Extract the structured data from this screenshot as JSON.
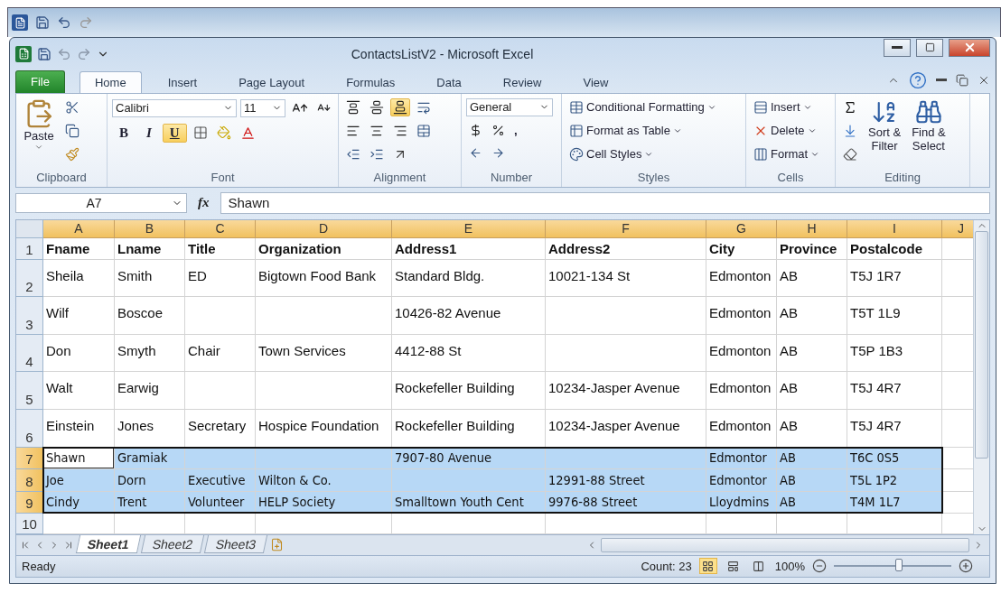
{
  "window": {
    "title": "ContactsListV2 - Microsoft Excel"
  },
  "ribbon_tabs": [
    {
      "label": "File",
      "kind": "file",
      "selected": false
    },
    {
      "label": "Home",
      "kind": "tab",
      "selected": true
    },
    {
      "label": "Insert",
      "kind": "tab",
      "selected": false
    },
    {
      "label": "Page Layout",
      "kind": "tab",
      "selected": false
    },
    {
      "label": "Formulas",
      "kind": "tab",
      "selected": false
    },
    {
      "label": "Data",
      "kind": "tab",
      "selected": false
    },
    {
      "label": "Review",
      "kind": "tab",
      "selected": false
    },
    {
      "label": "View",
      "kind": "tab",
      "selected": false
    }
  ],
  "ribbon": {
    "clipboard": {
      "paste": "Paste",
      "label": "Clipboard"
    },
    "font": {
      "name": "Calibri",
      "size": "11",
      "bold": {
        "label": "B",
        "pressed": false
      },
      "italic": {
        "label": "I",
        "pressed": false
      },
      "underline": {
        "label": "U",
        "pressed": true
      },
      "label": "Font"
    },
    "alignment": {
      "top": {
        "pressed": false
      },
      "middle": {
        "pressed": false
      },
      "bottom": {
        "pressed": true
      },
      "label": "Alignment"
    },
    "number": {
      "format": "General",
      "comma": ",",
      "label": "Number"
    },
    "styles": {
      "items": [
        "Conditional Formatting",
        "Format as Table",
        "Cell Styles"
      ],
      "label": "Styles"
    },
    "cells": {
      "items": [
        "Insert",
        "Delete",
        "Format"
      ],
      "label": "Cells"
    },
    "editing": {
      "sort": [
        "Sort &",
        "Filter"
      ],
      "find": [
        "Find &",
        "Select"
      ],
      "label": "Editing"
    }
  },
  "formula_bar": {
    "name_box": "A7",
    "function_label": "fx",
    "value": "Shawn"
  },
  "columns": [
    "A",
    "B",
    "C",
    "D",
    "E",
    "F",
    "G",
    "H",
    "I",
    "J"
  ],
  "rows": [
    {
      "number": "1",
      "kind": "heading",
      "selected": false,
      "cells": [
        {
          "text": "Fname",
          "active": false
        },
        {
          "text": "Lname",
          "active": false
        },
        {
          "text": "Title",
          "active": false
        },
        {
          "text": "Organization",
          "active": false
        },
        {
          "text": "Address1",
          "active": false
        },
        {
          "text": "Address2",
          "active": false
        },
        {
          "text": "City",
          "active": false
        },
        {
          "text": "Province",
          "active": false
        },
        {
          "text": "Postalcode",
          "active": false
        }
      ]
    },
    {
      "number": "2",
      "kind": "record",
      "selected": false,
      "cells": [
        {
          "text": "Sheila",
          "active": false
        },
        {
          "text": "Smith",
          "active": false
        },
        {
          "text": "ED",
          "active": false
        },
        {
          "text": "Bigtown Food Bank",
          "active": false
        },
        {
          "text": "Standard Bldg.",
          "active": false
        },
        {
          "text": "10021-134 St",
          "active": false
        },
        {
          "text": "Edmonton",
          "active": false
        },
        {
          "text": "AB",
          "active": false
        },
        {
          "text": "T5J 1R7",
          "active": false
        }
      ]
    },
    {
      "number": "3",
      "kind": "record",
      "selected": false,
      "cells": [
        {
          "text": "Wilf",
          "active": false
        },
        {
          "text": "Boscoe",
          "active": false
        },
        {
          "active": false
        },
        {
          "active": false
        },
        {
          "text": "10426-82 Avenue",
          "active": false
        },
        {
          "active": false
        },
        {
          "text": "Edmonton",
          "active": false
        },
        {
          "text": "AB",
          "active": false
        },
        {
          "text": "T5T 1L9",
          "active": false
        }
      ]
    },
    {
      "number": "4",
      "kind": "record",
      "selected": false,
      "cells": [
        {
          "text": "Don",
          "active": false
        },
        {
          "text": "Smyth",
          "active": false
        },
        {
          "text": "Chair",
          "active": false
        },
        {
          "text": "Town Services",
          "active": false
        },
        {
          "text": "4412-88 St",
          "active": false
        },
        {
          "active": false
        },
        {
          "text": "Edmonton",
          "active": false
        },
        {
          "text": "AB",
          "active": false
        },
        {
          "text": "T5P 1B3",
          "active": false
        }
      ]
    },
    {
      "number": "5",
      "kind": "record",
      "selected": false,
      "cells": [
        {
          "text": "Walt",
          "active": false
        },
        {
          "text": "Earwig",
          "active": false
        },
        {
          "active": false
        },
        {
          "active": false
        },
        {
          "text": "Rockefeller Building",
          "active": false
        },
        {
          "text": "10234-Jasper Avenue",
          "active": false
        },
        {
          "text": "Edmonton",
          "active": false
        },
        {
          "text": "AB",
          "active": false
        },
        {
          "text": "T5J 4R7",
          "active": false
        }
      ]
    },
    {
      "number": "6",
      "kind": "record",
      "selected": false,
      "cells": [
        {
          "text": "Einstein",
          "active": false
        },
        {
          "text": "Jones",
          "active": false
        },
        {
          "text": "Secretary",
          "active": false
        },
        {
          "text": "Hospice Foundation",
          "active": false
        },
        {
          "text": "Rockefeller Building",
          "active": false
        },
        {
          "text": "10234-Jasper Avenue",
          "active": false
        },
        {
          "text": "Edmonton",
          "active": false
        },
        {
          "text": "AB",
          "active": false
        },
        {
          "text": "T5J 4R7",
          "active": false
        }
      ]
    },
    {
      "number": "7",
      "kind": "pasted",
      "selected": true,
      "cells": [
        {
          "text": "Shawn",
          "active": true
        },
        {
          "text": "Gramiak",
          "active": false
        },
        {
          "active": false
        },
        {
          "active": false
        },
        {
          "text": "7907-80 Avenue",
          "active": false
        },
        {
          "active": false
        },
        {
          "text": "Edmontor",
          "active": false
        },
        {
          "text": "AB",
          "active": false
        },
        {
          "text": "T6C 0S5",
          "active": false
        }
      ]
    },
    {
      "number": "8",
      "kind": "pasted",
      "selected": true,
      "cells": [
        {
          "text": "Joe",
          "active": false
        },
        {
          "text": "Dorn",
          "active": false
        },
        {
          "text": "Executive",
          "active": false
        },
        {
          "text": "Wilton & Co.",
          "active": false
        },
        {
          "active": false
        },
        {
          "text": "12991-88 Street",
          "active": false
        },
        {
          "text": "Edmontor",
          "active": false
        },
        {
          "text": "AB",
          "active": false
        },
        {
          "text": "T5L 1P2",
          "active": false
        }
      ]
    },
    {
      "number": "9",
      "kind": "pasted",
      "selected": true,
      "cells": [
        {
          "text": "Cindy",
          "active": false
        },
        {
          "text": "Trent",
          "active": false
        },
        {
          "text": "Volunteer",
          "active": false
        },
        {
          "text": "HELP Society",
          "active": false
        },
        {
          "text": "Smalltown Youth Cent",
          "active": false
        },
        {
          "text": "9976-88 Street",
          "active": false
        },
        {
          "text": "Lloydmins",
          "active": false
        },
        {
          "text": "AB",
          "active": false
        },
        {
          "text": "T4M 1L7",
          "active": false
        }
      ]
    },
    {
      "number": "10",
      "kind": "blank",
      "selected": false
    }
  ],
  "sheet_tabs": [
    {
      "label": "Sheet1",
      "selected": true
    },
    {
      "label": "Sheet2",
      "selected": false
    },
    {
      "label": "Sheet3",
      "selected": false
    }
  ],
  "status_bar": {
    "status": "Ready",
    "count": "Count: 23",
    "views": [
      {
        "kind": "normal",
        "selected": true
      },
      {
        "kind": "page_layout",
        "selected": false
      },
      {
        "kind": "page_break",
        "selected": false
      }
    ],
    "zoom": "100%",
    "level": 0.55
  }
}
